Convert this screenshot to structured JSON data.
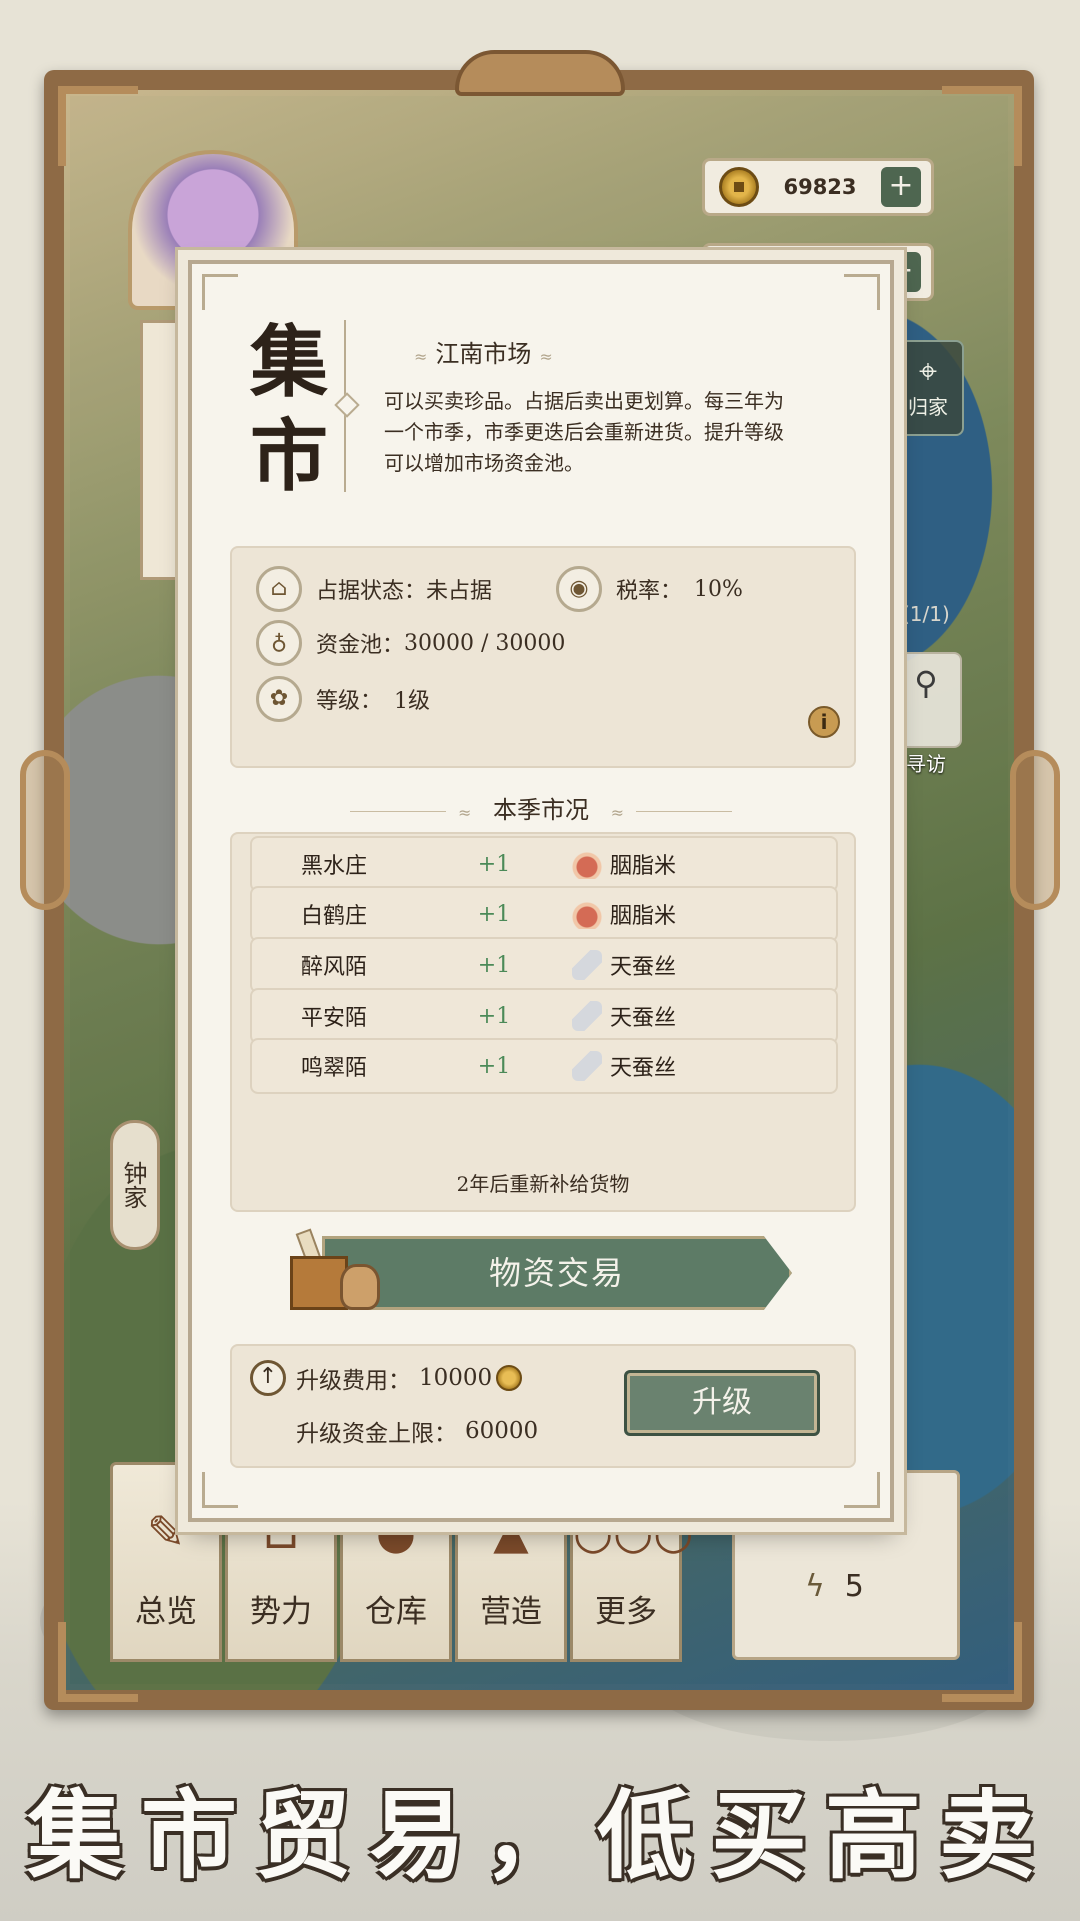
{
  "hud": {
    "coins": "69823",
    "plus_label": "+",
    "home_label": "归家",
    "search_label": "寻访",
    "left_label": "钟家",
    "map_counter": "(1/1)"
  },
  "modal": {
    "big_title": "集市",
    "subtitle": "江南市场",
    "description": "可以买卖珍品。占据后卖出更划算。每三年为一个市季，市季更迭后会重新进货。提升等级可以增加市场资金池。",
    "occupy_label": "占据状态：",
    "occupy_value": "未占据",
    "tax_label": "税率：",
    "tax_value": "10%",
    "fund_label": "资金池：",
    "fund_value": "30000 / 30000",
    "level_label": "等级：",
    "level_value": "1级",
    "info_label": "i",
    "section_title": "本季市况",
    "market_rows": [
      {
        "place": "黑水庄",
        "delta": "+1",
        "goods": "胭脂米",
        "icon": "rice-bag-icon"
      },
      {
        "place": "白鹤庄",
        "delta": "+1",
        "goods": "胭脂米",
        "icon": "rice-bag-icon"
      },
      {
        "place": "醉风陌",
        "delta": "+1",
        "goods": "天蚕丝",
        "icon": "silk-icon"
      },
      {
        "place": "平安陌",
        "delta": "+1",
        "goods": "天蚕丝",
        "icon": "silk-icon"
      },
      {
        "place": "鸣翠陌",
        "delta": "+1",
        "goods": "天蚕丝",
        "icon": "silk-icon"
      }
    ],
    "restock_note": "2年后重新补给货物",
    "trade_button": "物资交易",
    "upgrade_cost_label": "升级费用：",
    "upgrade_cost_value": "10000",
    "upgrade_cap_label": "升级资金上限：",
    "upgrade_cap_value": "60000",
    "upgrade_button": "升级"
  },
  "nav": [
    {
      "label": "总览",
      "icon": "brush-icon"
    },
    {
      "label": "势力",
      "icon": "building-icon"
    },
    {
      "label": "仓库",
      "icon": "pouch-icon"
    },
    {
      "label": "营造",
      "icon": "trowel-icon"
    },
    {
      "label": "更多",
      "icon": "more-icon"
    }
  ],
  "turn": {
    "energy": "5"
  },
  "slogan": "集市贸易，低买高卖",
  "colors": {
    "accent_green": "#5d7b66",
    "frame_brown": "#8e6a45",
    "positive": "#4b8a58"
  }
}
